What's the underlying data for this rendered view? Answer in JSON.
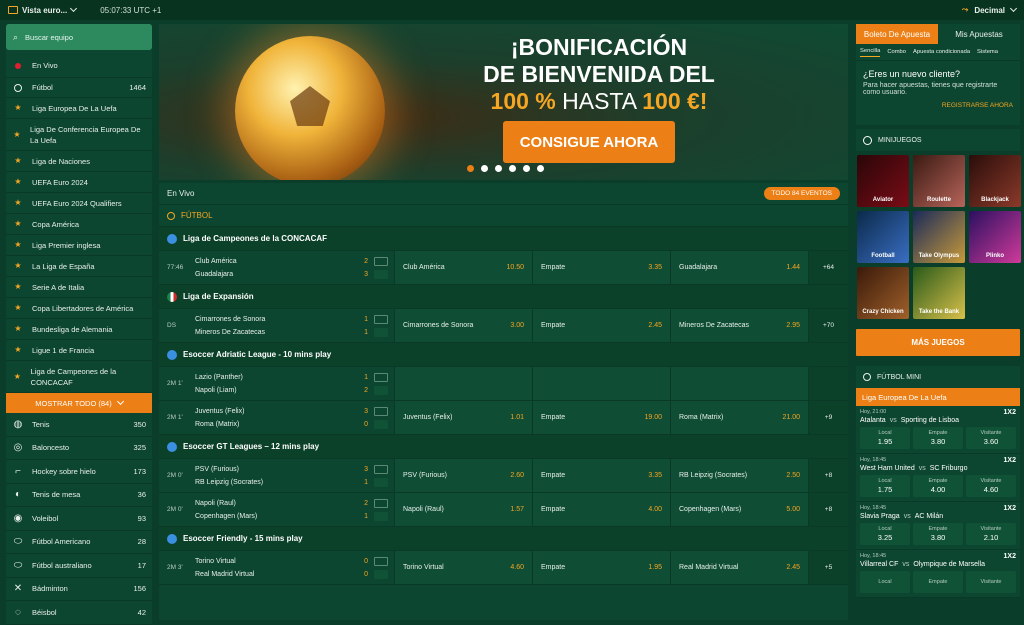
{
  "topbar": {
    "view_label": "Vista euro...",
    "clock": "05:07:33 UTC +1",
    "odds_format": "Decimal"
  },
  "sidebar": {
    "search_placeholder": "Buscar equipo",
    "live": "En Vivo",
    "football": {
      "label": "Fútbol",
      "count": "1464"
    },
    "leagues": [
      "Liga Europea De La Uefa",
      "Liga De Conferencia Europea De La Uefa",
      "Liga de Naciones",
      "UEFA Euro 2024",
      "UEFA Euro 2024 Qualifiers",
      "Copa América",
      "Liga Premier inglesa",
      "La Liga de España",
      "Serie A de Italia",
      "Copa Libertadores de América",
      "Bundesliga de Alemania",
      "Ligue 1 de Francia",
      "Liga de Campeones de la CONCACAF"
    ],
    "show_all": "MOSTRAR TODO (84)",
    "sports": [
      {
        "label": "Tenis",
        "count": "350",
        "icon": "tennis-icon"
      },
      {
        "label": "Baloncesto",
        "count": "325",
        "icon": "basketball-icon"
      },
      {
        "label": "Hockey sobre hielo",
        "count": "173",
        "icon": "hockey-icon"
      },
      {
        "label": "Tenis de mesa",
        "count": "36",
        "icon": "table-tennis-icon"
      },
      {
        "label": "Voleibol",
        "count": "93",
        "icon": "volleyball-icon"
      },
      {
        "label": "Fútbol Americano",
        "count": "28",
        "icon": "american-football-icon"
      },
      {
        "label": "Fútbol australiano",
        "count": "17",
        "icon": "australian-football-icon"
      },
      {
        "label": "Bádminton",
        "count": "156",
        "icon": "badminton-icon"
      },
      {
        "label": "Béisbol",
        "count": "42",
        "icon": "baseball-icon"
      }
    ]
  },
  "banner": {
    "line1": "¡BONIFICACIÓN",
    "line2": "DE BIENVENIDA DEL",
    "line3a": "100 %",
    "line3b": " HASTA ",
    "line3c": "100 €!",
    "cta": "CONSIGUE AHORA"
  },
  "main": {
    "live_title": "En Vivo",
    "all_events": "TODO 84 EVENTOS",
    "sport": "FÚTBOL",
    "leagues": [
      {
        "name": "Liga de Campeones de la CONCACAF",
        "matches": [
          {
            "time": "77:46",
            "home": "Club América",
            "away": "Guadalajara",
            "hs": "2",
            "as": "3",
            "o1": "Club América",
            "v1": "10.50",
            "o2": "Empate",
            "v2": "3.35",
            "o3": "Guadalajara",
            "v3": "1.44",
            "more": "+64"
          }
        ]
      },
      {
        "name": "Liga de Expansión",
        "matches": [
          {
            "time": "DS",
            "home": "Cimarrones de Sonora",
            "away": "Mineros De Zacatecas",
            "hs": "1",
            "as": "1",
            "o1": "Cimarrones de Sonora",
            "v1": "3.00",
            "o2": "Empate",
            "v2": "2.45",
            "o3": "Mineros De Zacatecas",
            "v3": "2.95",
            "more": "+70"
          }
        ]
      },
      {
        "name": "Esoccer Adriatic League - 10 mins play",
        "matches": [
          {
            "time": "2M 1'",
            "home": "Lazio (Panther)",
            "away": "Napoli (Liam)",
            "hs": "1",
            "as": "2",
            "o1": "",
            "v1": "",
            "o2": "",
            "v2": "",
            "o3": "",
            "v3": "",
            "more": ""
          },
          {
            "time": "2M 1'",
            "home": "Juventus (Felix)",
            "away": "Roma (Matrix)",
            "hs": "3",
            "as": "0",
            "o1": "Juventus (Felix)",
            "v1": "1.01",
            "o2": "Empate",
            "v2": "19.00",
            "o3": "Roma (Matrix)",
            "v3": "21.00",
            "more": "+9"
          }
        ]
      },
      {
        "name": "Esoccer GT Leagues – 12 mins play",
        "matches": [
          {
            "time": "2M 0'",
            "home": "PSV (Furious)",
            "away": "RB Leipzig (Socrates)",
            "hs": "3",
            "as": "1",
            "o1": "PSV (Furious)",
            "v1": "2.60",
            "o2": "Empate",
            "v2": "3.35",
            "o3": "RB Leipzig (Socrates)",
            "v3": "2.50",
            "more": "+8"
          },
          {
            "time": "2M 0'",
            "home": "Napoli (Raul)",
            "away": "Copenhagen (Mars)",
            "hs": "2",
            "as": "1",
            "o1": "Napoli (Raul)",
            "v1": "1.57",
            "o2": "Empate",
            "v2": "4.00",
            "o3": "Copenhagen (Mars)",
            "v3": "5.00",
            "more": "+8"
          }
        ]
      },
      {
        "name": "Esoccer Friendly - 15 mins play",
        "matches": [
          {
            "time": "2M 3'",
            "home": "Torino Virtual",
            "away": "Real Madrid Virtual",
            "hs": "0",
            "as": "0",
            "o1": "Torino Virtual",
            "v1": "4.60",
            "o2": "Empate",
            "v2": "1.95",
            "o3": "Real Madrid Virtual",
            "v3": "2.45",
            "more": "+5"
          }
        ]
      }
    ]
  },
  "right": {
    "tab_betslip": "Boleto De Apuesta",
    "tab_mybets": "Mis Apuestas",
    "subtabs": [
      "Sencilla",
      "Combo",
      "Apuesta condicionada",
      "Sistema"
    ],
    "new_title": "¿Eres un nuevo cliente?",
    "new_text": "Para hacer apuestas, tienes que registrarte como usuario.",
    "register": "REGISTRARSE AHORA",
    "minigames_title": "MINIJUEGOS",
    "games": [
      "Aviator",
      "Roulette",
      "Blackjack",
      "Football",
      "Take Olympus",
      "Plinko",
      "Crazy Chicken",
      "Take the Bank"
    ],
    "more_games": "MÁS JUEGOS",
    "mini_title": "FÚTBOL MINI",
    "mini_league": "Liga Europea De La Uefa",
    "mini_matches": [
      {
        "time": "Hoy, 21:00",
        "type": "1X2",
        "home": "Atalanta",
        "away": "Sporting de Lisboa",
        "l": "1.95",
        "e": "3.80",
        "v": "3.60"
      },
      {
        "time": "Hoy, 18:45",
        "type": "1X2",
        "home": "West Ham United",
        "away": "SC Friburgo",
        "l": "1.75",
        "e": "4.00",
        "v": "4.60"
      },
      {
        "time": "Hoy, 18:45",
        "type": "1X2",
        "home": "Slavia Praga",
        "away": "AC Milán",
        "l": "3.25",
        "e": "3.80",
        "v": "2.10"
      },
      {
        "time": "Hoy, 18:45",
        "type": "1X2",
        "home": "Villarreal CF",
        "away": "Olympique de Marsella",
        "l": "",
        "e": "",
        "v": ""
      }
    ],
    "labels": {
      "local": "Local",
      "empate": "Empate",
      "visitante": "Visitante",
      "vs": "vs"
    }
  },
  "colors": {
    "accent": "#ec7f15",
    "bg": "#0a3d2a",
    "panel": "#0d4630"
  }
}
